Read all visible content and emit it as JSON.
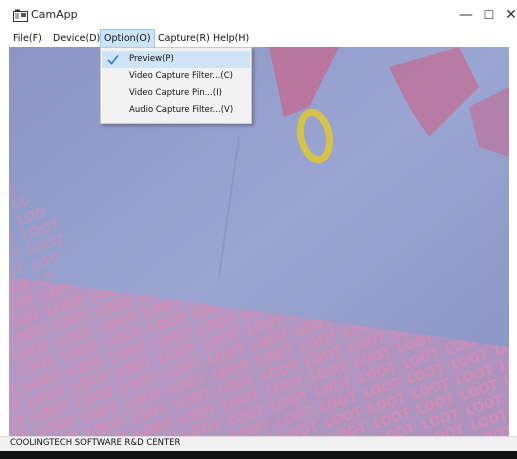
{
  "window": {
    "title": "CamApp",
    "minimize_glyph": "—",
    "maximize_glyph": "☐",
    "close_glyph": "✕"
  },
  "menu": {
    "items": [
      {
        "label": "File(F)"
      },
      {
        "label": "Device(D)"
      },
      {
        "label": "Option(O)"
      },
      {
        "label": "Capture(R)"
      },
      {
        "label": "Help(H)"
      }
    ],
    "active_index": 2
  },
  "dropdown": {
    "items": [
      {
        "label": "Preview(P)",
        "checked": true
      },
      {
        "label": "Video Capture Filter...(C)",
        "checked": false
      },
      {
        "label": "Video Capture Pin...(I)",
        "checked": false
      },
      {
        "label": "Audio Capture Filter...(V)",
        "checked": false
      }
    ]
  },
  "status": {
    "text": "COOLINGTECH SOFTWARE R&D CENTER"
  },
  "colors": {
    "video_bg": "#8f9bc9",
    "pink_text": "#d77fb0",
    "ring": "#d4c24a",
    "menu_highlight": "#cce4f7",
    "check": "#2d7fd6"
  },
  "icons": {
    "app": "camera-app-icon",
    "check": "checkmark-icon"
  }
}
